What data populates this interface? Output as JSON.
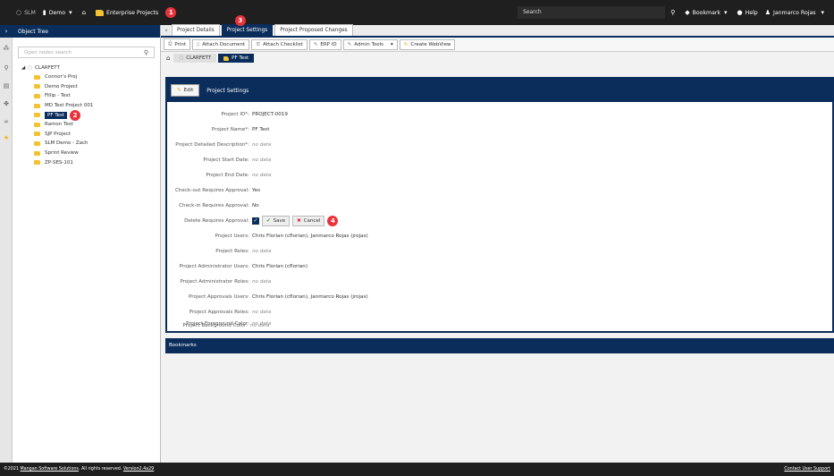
{
  "topbar": {
    "app": "SLM",
    "workspace": "Demo",
    "breadcrumb": "Enterprise Projects",
    "badge1": "1",
    "search_placeholder": "Search",
    "bookmark": "Bookmark",
    "help": "Help",
    "user": "Janmarco Rojas"
  },
  "tree": {
    "header": "Object Tree",
    "search_placeholder": "Open nodes search",
    "root": "CLARFETT",
    "badge2": "2",
    "items": [
      "Connor's Proj",
      "Demo Project",
      "Fillip - Test",
      "MD Test Project 001",
      "PF Test",
      "Ramon Test",
      "SJP Project",
      "SLM Demo - Zach",
      "Sprint Review",
      "ZP-SES-101"
    ]
  },
  "tabs": {
    "t1": "Project Details",
    "t2": "Project Settings",
    "t3": "Project Proposed Changes",
    "badge3": "3"
  },
  "toolbar": {
    "print": "Print",
    "attach_doc": "Attach Document",
    "attach_check": "Attach Checklist",
    "erp": "ERP ID",
    "admin": "Admin Tools",
    "webview": "Create WebView"
  },
  "crumbs": {
    "root": "CLARFETT",
    "current": "PF Test"
  },
  "panel": {
    "edit": "Edit",
    "title": "Project Settings",
    "save": "Save",
    "cancel": "Cancel",
    "badge4": "4",
    "fields": [
      {
        "label": "Project ID*:",
        "value": "PROJECT-0019"
      },
      {
        "label": "Project Name*:",
        "value": "PF Test"
      },
      {
        "label": "Project Detailed Description*:",
        "value": "no data"
      },
      {
        "label": "Project Start Date:",
        "value": "no data"
      },
      {
        "label": "Project End Date:",
        "value": "no data"
      },
      {
        "label": "Check-out Requires Approval:",
        "value": "Yes"
      },
      {
        "label": "Check-in Requires Approval:",
        "value": "No"
      },
      {
        "label": "Delete Requires Approval:",
        "value": ""
      },
      {
        "label": "Project Users:",
        "value": "Chris Florian (cflorian), Janmarco Rojas (jrojas)"
      },
      {
        "label": "Project Roles:",
        "value": "no data"
      },
      {
        "label": "Project Administrator Users:",
        "value": "Chris Florian (cflorian)"
      },
      {
        "label": "Project Administrator Roles:",
        "value": "no data"
      },
      {
        "label": "Project Approvals Users:",
        "value": "Chris Florian (cflorian), Janmarco Rojas (jrojas)"
      },
      {
        "label": "Project Approvals Roles:",
        "value": "no data"
      },
      {
        "label": "Project Foreground Color:",
        "value": "no data"
      },
      {
        "label": "Project Background Color:",
        "value": "no data"
      }
    ]
  },
  "bookmarks": "Bookmarks",
  "footer": {
    "copyright": "©2021",
    "company": "Mangan Software Solutions",
    "rights": ". All rights reserved.",
    "version": "Version2.4a29",
    "contact": "Contact User Support"
  }
}
